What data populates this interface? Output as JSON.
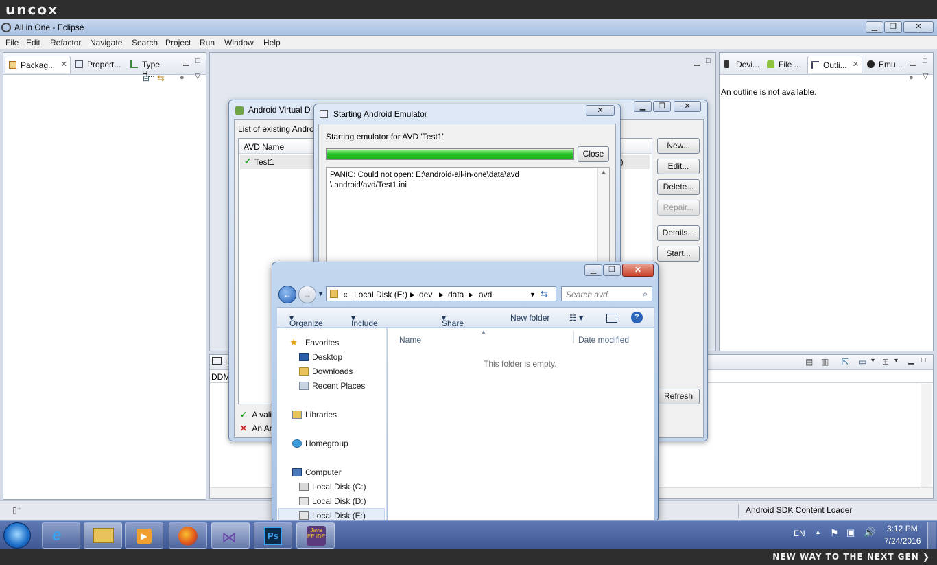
{
  "branding": {
    "logo": "uncox",
    "tagline": "NEW WAY TO THE NEXT GEN ❯"
  },
  "eclipse": {
    "title": "All in One - Eclipse",
    "menu": [
      "File",
      "Edit",
      "Refactor",
      "Navigate",
      "Search",
      "Project",
      "Run",
      "Window",
      "Help"
    ],
    "left_tabs": [
      "Packag...",
      "Propert...",
      "Type H..."
    ],
    "right_tabs": [
      "Devi...",
      "File ...",
      "Outli...",
      "Emu..."
    ],
    "outline_message": "An outline is not available.",
    "bottom_panel_label": "DDM",
    "bottom_tab_label": "L",
    "status_right": "Android SDK Content Loader"
  },
  "avd_manager": {
    "title": "Android Virtual D",
    "list_label": "List of existing Andro",
    "column_avd_name": "AVD Name",
    "rows": [
      {
        "name": "Test1",
        "tail": "i)"
      }
    ],
    "buttons": {
      "new": "New...",
      "edit": "Edit...",
      "delete": "Delete...",
      "repair": "Repair...",
      "details": "Details...",
      "start": "Start...",
      "refresh": "Refresh"
    },
    "legend_valid": "A vali",
    "legend_invalid": "An An"
  },
  "emulator_dialog": {
    "title": "Starting Android Emulator",
    "message": "Starting emulator for AVD 'Test1'",
    "progress": 1.0,
    "close_button": "Close",
    "log": "PANIC: Could not open: E:\\android-all-in-one\\data\\avd\n\\.android/avd/Test1.ini"
  },
  "explorer": {
    "path_prefix": "«",
    "path": [
      "Local Disk (E:)",
      "dev",
      "data",
      "avd"
    ],
    "search_placeholder": "Search avd",
    "commands": {
      "organize": "Organize",
      "include": "Include in library",
      "share": "Share with",
      "new_folder": "New folder"
    },
    "columns": {
      "name": "Name",
      "date": "Date modified"
    },
    "empty_message": "This folder is empty.",
    "nav": {
      "favorites": "Favorites",
      "desktop": "Desktop",
      "downloads": "Downloads",
      "recent": "Recent Places",
      "libraries": "Libraries",
      "homegroup": "Homegroup",
      "computer": "Computer",
      "disk_c": "Local Disk (C:)",
      "disk_d": "Local Disk (D:)",
      "disk_e": "Local Disk (E:)"
    }
  },
  "taskbar": {
    "language": "EN",
    "time": "3:12 PM",
    "date": "7/24/2016",
    "javaee_label": "Java EE IDE"
  }
}
